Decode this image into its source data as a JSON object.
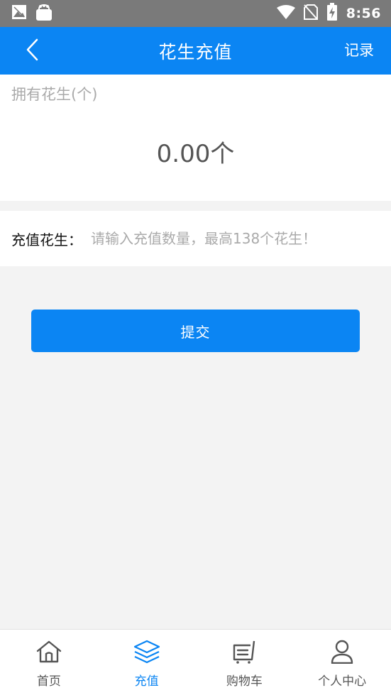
{
  "status_bar": {
    "time": "8:56",
    "icons": [
      "photo-icon",
      "bag-icon",
      "wifi-icon",
      "no-sim-icon",
      "battery-charging-icon"
    ]
  },
  "nav": {
    "title": "花生充值",
    "record_label": "记录",
    "back_icon": "back-chevron-icon"
  },
  "balance": {
    "label": "拥有花生(个)",
    "amount": "0.00个"
  },
  "recharge": {
    "label": "充值花生：",
    "value": "",
    "placeholder": "请输入充值数量，最高138个花生！"
  },
  "submit_label": "提交",
  "tabs": [
    {
      "label": "首页",
      "icon": "home-icon",
      "active": false
    },
    {
      "label": "充值",
      "icon": "layers-icon",
      "active": true
    },
    {
      "label": "购物车",
      "icon": "cart-icon",
      "active": false
    },
    {
      "label": "个人中心",
      "icon": "user-icon",
      "active": false
    }
  ],
  "colors": {
    "accent": "#0b85f3",
    "status_bar": "#7a7a7a",
    "background": "#f3f3f3"
  }
}
